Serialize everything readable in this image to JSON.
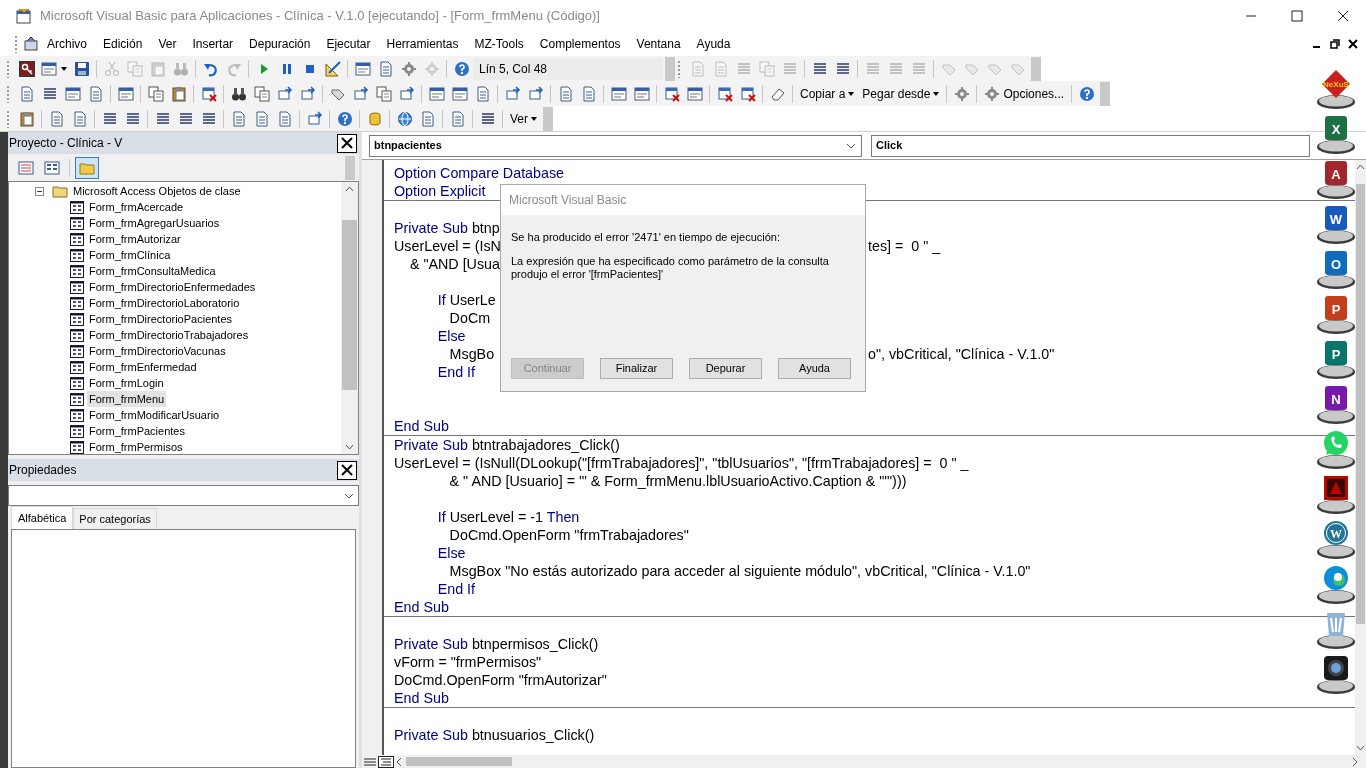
{
  "window": {
    "title": "Microsoft Visual Basic para Aplicaciones - Clínica - V.1.0 [ejecutando] - [Form_frmMenu (Código)]"
  },
  "menu": [
    "Archivo",
    "Edición",
    "Ver",
    "Insertar",
    "Depuración",
    "Ejecutar",
    "Herramientas",
    "MZ-Tools",
    "Complementos",
    "Ventana",
    "Ayuda"
  ],
  "toolbars": [
    {
      "items": [
        {
          "kind": "button",
          "disabled": false
        },
        {
          "kind": "split",
          "disabled": false
        },
        {
          "kind": "button",
          "disabled": false
        },
        {
          "kind": "separator"
        },
        {
          "kind": "button",
          "disabled": true
        },
        {
          "kind": "button",
          "disabled": true
        },
        {
          "kind": "button",
          "disabled": true
        },
        {
          "kind": "button",
          "disabled": true
        },
        {
          "kind": "separator"
        },
        {
          "kind": "button",
          "disabled": false
        },
        {
          "kind": "button",
          "disabled": true
        },
        {
          "kind": "separator"
        },
        {
          "kind": "button",
          "disabled": false
        },
        {
          "kind": "button",
          "disabled": false
        },
        {
          "kind": "button",
          "disabled": false
        },
        {
          "kind": "button",
          "disabled": false
        },
        {
          "kind": "separator"
        },
        {
          "kind": "button",
          "disabled": false
        },
        {
          "kind": "button",
          "disabled": false
        },
        {
          "kind": "button",
          "disabled": false
        },
        {
          "kind": "button",
          "disabled": true
        },
        {
          "kind": "separator"
        },
        {
          "kind": "button",
          "disabled": false
        },
        {
          "kind": "field",
          "value": "Lín 5, Col 48"
        },
        {
          "kind": "overflow"
        },
        {
          "kind": "grip"
        },
        {
          "kind": "button",
          "disabled": true
        },
        {
          "kind": "button",
          "disabled": true
        },
        {
          "kind": "button",
          "disabled": true
        },
        {
          "kind": "button",
          "disabled": true
        },
        {
          "kind": "button",
          "disabled": true
        },
        {
          "kind": "separator"
        },
        {
          "kind": "button",
          "disabled": false
        },
        {
          "kind": "button",
          "disabled": false
        },
        {
          "kind": "separator"
        },
        {
          "kind": "button",
          "disabled": true
        },
        {
          "kind": "button",
          "disabled": true
        },
        {
          "kind": "button",
          "disabled": true
        },
        {
          "kind": "separator"
        },
        {
          "kind": "button",
          "disabled": true
        },
        {
          "kind": "button",
          "disabled": true
        },
        {
          "kind": "button",
          "disabled": true
        },
        {
          "kind": "button",
          "disabled": true
        },
        {
          "kind": "overflow"
        }
      ]
    },
    {
      "items": [
        {
          "kind": "button",
          "disabled": false
        },
        {
          "kind": "button",
          "disabled": false
        },
        {
          "kind": "button",
          "disabled": false
        },
        {
          "kind": "button",
          "disabled": false
        },
        {
          "kind": "separator"
        },
        {
          "kind": "button",
          "disabled": false
        },
        {
          "kind": "separator"
        },
        {
          "kind": "button",
          "disabled": false
        },
        {
          "kind": "button",
          "disabled": false
        },
        {
          "kind": "separator"
        },
        {
          "kind": "button",
          "disabled": false
        },
        {
          "kind": "separator"
        },
        {
          "kind": "button",
          "disabled": false
        },
        {
          "kind": "button",
          "disabled": false
        },
        {
          "kind": "button",
          "disabled": false
        },
        {
          "kind": "button",
          "disabled": false
        },
        {
          "kind": "separator"
        },
        {
          "kind": "button",
          "disabled": false
        },
        {
          "kind": "button",
          "disabled": false
        },
        {
          "kind": "button",
          "disabled": false
        },
        {
          "kind": "button",
          "disabled": false
        },
        {
          "kind": "separator"
        },
        {
          "kind": "button",
          "disabled": false
        },
        {
          "kind": "button",
          "disabled": false
        },
        {
          "kind": "button",
          "disabled": false
        },
        {
          "kind": "separator"
        },
        {
          "kind": "button",
          "disabled": false
        },
        {
          "kind": "button",
          "disabled": false
        },
        {
          "kind": "separator"
        },
        {
          "kind": "button",
          "disabled": false
        },
        {
          "kind": "button",
          "disabled": false
        },
        {
          "kind": "separator"
        },
        {
          "kind": "button",
          "disabled": false
        },
        {
          "kind": "button",
          "disabled": false
        },
        {
          "kind": "separator"
        },
        {
          "kind": "button",
          "disabled": false
        },
        {
          "kind": "button",
          "disabled": false
        },
        {
          "kind": "separator"
        },
        {
          "kind": "button",
          "disabled": false
        },
        {
          "kind": "button",
          "disabled": false
        },
        {
          "kind": "separator"
        },
        {
          "kind": "button",
          "disabled": false
        },
        {
          "kind": "separator"
        },
        {
          "kind": "menu",
          "label": "Copiar a"
        },
        {
          "kind": "menu",
          "label": "Pegar desde"
        },
        {
          "kind": "separator"
        },
        {
          "kind": "button",
          "disabled": false
        },
        {
          "kind": "separator"
        },
        {
          "kind": "labeled",
          "label": "Opciones..."
        },
        {
          "kind": "separator"
        },
        {
          "kind": "button",
          "disabled": false
        },
        {
          "kind": "overflow"
        }
      ]
    },
    {
      "items": [
        {
          "kind": "button",
          "disabled": false
        },
        {
          "kind": "separator"
        },
        {
          "kind": "button",
          "disabled": false
        },
        {
          "kind": "button",
          "disabled": false
        },
        {
          "kind": "separator"
        },
        {
          "kind": "button",
          "disabled": false
        },
        {
          "kind": "button",
          "disabled": false
        },
        {
          "kind": "separator"
        },
        {
          "kind": "button",
          "disabled": false
        },
        {
          "kind": "button",
          "disabled": false
        },
        {
          "kind": "button",
          "disabled": false
        },
        {
          "kind": "separator"
        },
        {
          "kind": "button",
          "disabled": false
        },
        {
          "kind": "button",
          "disabled": false
        },
        {
          "kind": "button",
          "disabled": false
        },
        {
          "kind": "separator"
        },
        {
          "kind": "button",
          "disabled": false
        },
        {
          "kind": "separator"
        },
        {
          "kind": "button",
          "disabled": false
        },
        {
          "kind": "separator"
        },
        {
          "kind": "button",
          "disabled": false
        },
        {
          "kind": "separator"
        },
        {
          "kind": "button",
          "disabled": false
        },
        {
          "kind": "button",
          "disabled": false
        },
        {
          "kind": "separator"
        },
        {
          "kind": "button",
          "disabled": false
        },
        {
          "kind": "separator"
        },
        {
          "kind": "button",
          "disabled": false
        },
        {
          "kind": "separator"
        },
        {
          "kind": "menu",
          "label": "Ver"
        },
        {
          "kind": "overflow"
        }
      ]
    }
  ],
  "project": {
    "title": "Proyecto - Clínica - V",
    "view_buttons": [
      {
        "selected": false
      },
      {
        "selected": false
      },
      {
        "selected": true
      }
    ],
    "tree": [
      {
        "label": "Microsoft Access Objetos de clase",
        "expanded": true,
        "children": [
          {
            "label": "Form_frmAcercade",
            "selected": false
          },
          {
            "label": "Form_frmAgregarUsuarios",
            "selected": false
          },
          {
            "label": "Form_frmAutorizar",
            "selected": false
          },
          {
            "label": "Form_frmClínica",
            "selected": false
          },
          {
            "label": "Form_frmConsultaMedica",
            "selected": false
          },
          {
            "label": "Form_frmDirectorioEnfermedades",
            "selected": false
          },
          {
            "label": "Form_frmDirectorioLaboratorio",
            "selected": false
          },
          {
            "label": "Form_frmDirectorioPacientes",
            "selected": false
          },
          {
            "label": "Form_frmDirectorioTrabajadores",
            "selected": false
          },
          {
            "label": "Form_frmDirectorioVacunas",
            "selected": false
          },
          {
            "label": "Form_frmEnfermedad",
            "selected": false
          },
          {
            "label": "Form_frmLogin",
            "selected": false
          },
          {
            "label": "Form_frmMenu",
            "selected": true
          },
          {
            "label": "Form_frmModificarUsuario",
            "selected": false
          },
          {
            "label": "Form_frmPacientes",
            "selected": false
          },
          {
            "label": "Form_frmPermisos",
            "selected": false
          }
        ]
      }
    ]
  },
  "properties": {
    "title": "Propiedades",
    "tabs": [
      {
        "label": "Alfabética",
        "selected": true
      },
      {
        "label": "Por categorías",
        "selected": false
      }
    ]
  },
  "code": {
    "object": "btnpacientes",
    "procedure": "Click",
    "procedures": [
      {
        "lines": [
          {
            "kind": "code",
            "parts": [
              {
                "text": "Option Compare Database",
                "keyword": true
              }
            ]
          },
          {
            "kind": "code",
            "parts": [
              {
                "text": "Option Explicit",
                "keyword": true
              }
            ]
          }
        ]
      },
      {
        "lines": [
          {
            "kind": "blank"
          },
          {
            "kind": "code",
            "parts": [
              {
                "text": "Private Sub ",
                "keyword": true
              },
              {
                "text": "btnp",
                "keyword": false
              }
            ]
          },
          {
            "kind": "code",
            "parts": [
              {
                "text": "UserLevel = (IsN",
                "keyword": false
              }
            ],
            "tail": "tes] =  0 \" _"
          },
          {
            "kind": "code",
            "parts": [
              {
                "text": "    & \"AND [Usua",
                "keyword": false
              }
            ]
          },
          {
            "kind": "blank"
          },
          {
            "kind": "code",
            "parts": [
              {
                "text": "           If ",
                "keyword": true
              },
              {
                "text": "UserLe",
                "keyword": false
              }
            ]
          },
          {
            "kind": "code",
            "parts": [
              {
                "text": "              DoCm",
                "keyword": false
              }
            ]
          },
          {
            "kind": "code",
            "parts": [
              {
                "text": "           Else",
                "keyword": true
              }
            ]
          },
          {
            "kind": "code",
            "parts": [
              {
                "text": "              MsgBo",
                "keyword": false
              }
            ],
            "tail": "o\", vbCritical, \"Clínica - V.1.0\""
          },
          {
            "kind": "code",
            "parts": [
              {
                "text": "           End If",
                "keyword": true
              }
            ]
          },
          {
            "kind": "blank"
          },
          {
            "kind": "blank"
          },
          {
            "kind": "code",
            "parts": [
              {
                "text": "End Sub",
                "keyword": true
              }
            ]
          }
        ]
      },
      {
        "lines": [
          {
            "kind": "code",
            "parts": [
              {
                "text": "Private Sub ",
                "keyword": true
              },
              {
                "text": "btntrabajadores_Click()",
                "keyword": false
              }
            ]
          },
          {
            "kind": "code",
            "parts": [
              {
                "text": "UserLevel = (IsNull(DLookup(\"[frmTrabajadores]\", \"tblUsuarios\", \"[frmTrabajadores] =  0 \" _",
                "keyword": false
              }
            ]
          },
          {
            "kind": "code",
            "parts": [
              {
                "text": "              & \" AND [Usuario] = '\" & Form_frmMenu.lblUsuarioActivo.Caption & \"'\")))",
                "keyword": false
              }
            ]
          },
          {
            "kind": "blank"
          },
          {
            "kind": "code",
            "parts": [
              {
                "text": "           If ",
                "keyword": true
              },
              {
                "text": "UserLevel = -1 ",
                "keyword": false
              },
              {
                "text": "Then",
                "keyword": true
              }
            ]
          },
          {
            "kind": "code",
            "parts": [
              {
                "text": "              DoCmd.OpenForm \"frmTrabajadores\"",
                "keyword": false
              }
            ]
          },
          {
            "kind": "code",
            "parts": [
              {
                "text": "           Else",
                "keyword": true
              }
            ]
          },
          {
            "kind": "code",
            "parts": [
              {
                "text": "              MsgBox \"No estás autorizado para acceder al siguiente módulo\", vbCritical, \"Clínica - V.1.0\"",
                "keyword": false
              }
            ]
          },
          {
            "kind": "code",
            "parts": [
              {
                "text": "           End If",
                "keyword": true
              }
            ]
          },
          {
            "kind": "code",
            "parts": [
              {
                "text": "End Sub",
                "keyword": true
              }
            ]
          }
        ]
      },
      {
        "lines": [
          {
            "kind": "blank"
          },
          {
            "kind": "code",
            "parts": [
              {
                "text": "Private Sub ",
                "keyword": true
              },
              {
                "text": "btnpermisos_Click()",
                "keyword": false
              }
            ]
          },
          {
            "kind": "code",
            "parts": [
              {
                "text": "vForm = \"frmPermisos\"",
                "keyword": false
              }
            ]
          },
          {
            "kind": "code",
            "parts": [
              {
                "text": "DoCmd.OpenForm \"frmAutorizar\"",
                "keyword": false
              }
            ]
          },
          {
            "kind": "code",
            "parts": [
              {
                "text": "End Sub",
                "keyword": true
              }
            ]
          }
        ]
      },
      {
        "lines": [
          {
            "kind": "blank"
          },
          {
            "kind": "code",
            "parts": [
              {
                "text": "Private Sub ",
                "keyword": true
              },
              {
                "text": "btnusuarios_Click()",
                "keyword": false
              }
            ]
          }
        ]
      }
    ]
  },
  "dialog": {
    "title": "Microsoft Visual Basic",
    "messages": [
      "Se ha producido el error '2471' en tiempo de ejecución:",
      "La expresión que ha especificado como parámetro de la consulta produjo el error '[frmPacientes]'"
    ],
    "buttons": [
      {
        "label": "Continuar",
        "disabled": true
      },
      {
        "label": "Finalizar",
        "disabled": false
      },
      {
        "label": "Depurar",
        "disabled": false
      },
      {
        "label": "Ayuda",
        "disabled": false
      }
    ]
  },
  "dock": [
    {
      "kind": "diamond",
      "label": "NeXuS",
      "color": "#c8201e"
    },
    {
      "kind": "tile",
      "label": "X",
      "color": "#1d7044"
    },
    {
      "kind": "tile",
      "label": "A",
      "color": "#a4262c"
    },
    {
      "kind": "tile",
      "label": "W",
      "color": "#185abd"
    },
    {
      "kind": "tile",
      "label": "O",
      "color": "#0f6cbd"
    },
    {
      "kind": "tile",
      "label": "P",
      "color": "#c43e1c"
    },
    {
      "kind": "tile",
      "label": "P",
      "color": "#077568"
    },
    {
      "kind": "tile",
      "label": "N",
      "color": "#7719aa"
    },
    {
      "kind": "chat",
      "color": "#25d366"
    },
    {
      "kind": "document",
      "color": "#b30b00"
    },
    {
      "kind": "round",
      "label": "W",
      "color": "#21759b"
    },
    {
      "kind": "swirl",
      "color": "#0c8fd8"
    },
    {
      "kind": "bin",
      "color": "#8fb3d9"
    },
    {
      "kind": "camera",
      "color": "#1a1a1a"
    }
  ]
}
